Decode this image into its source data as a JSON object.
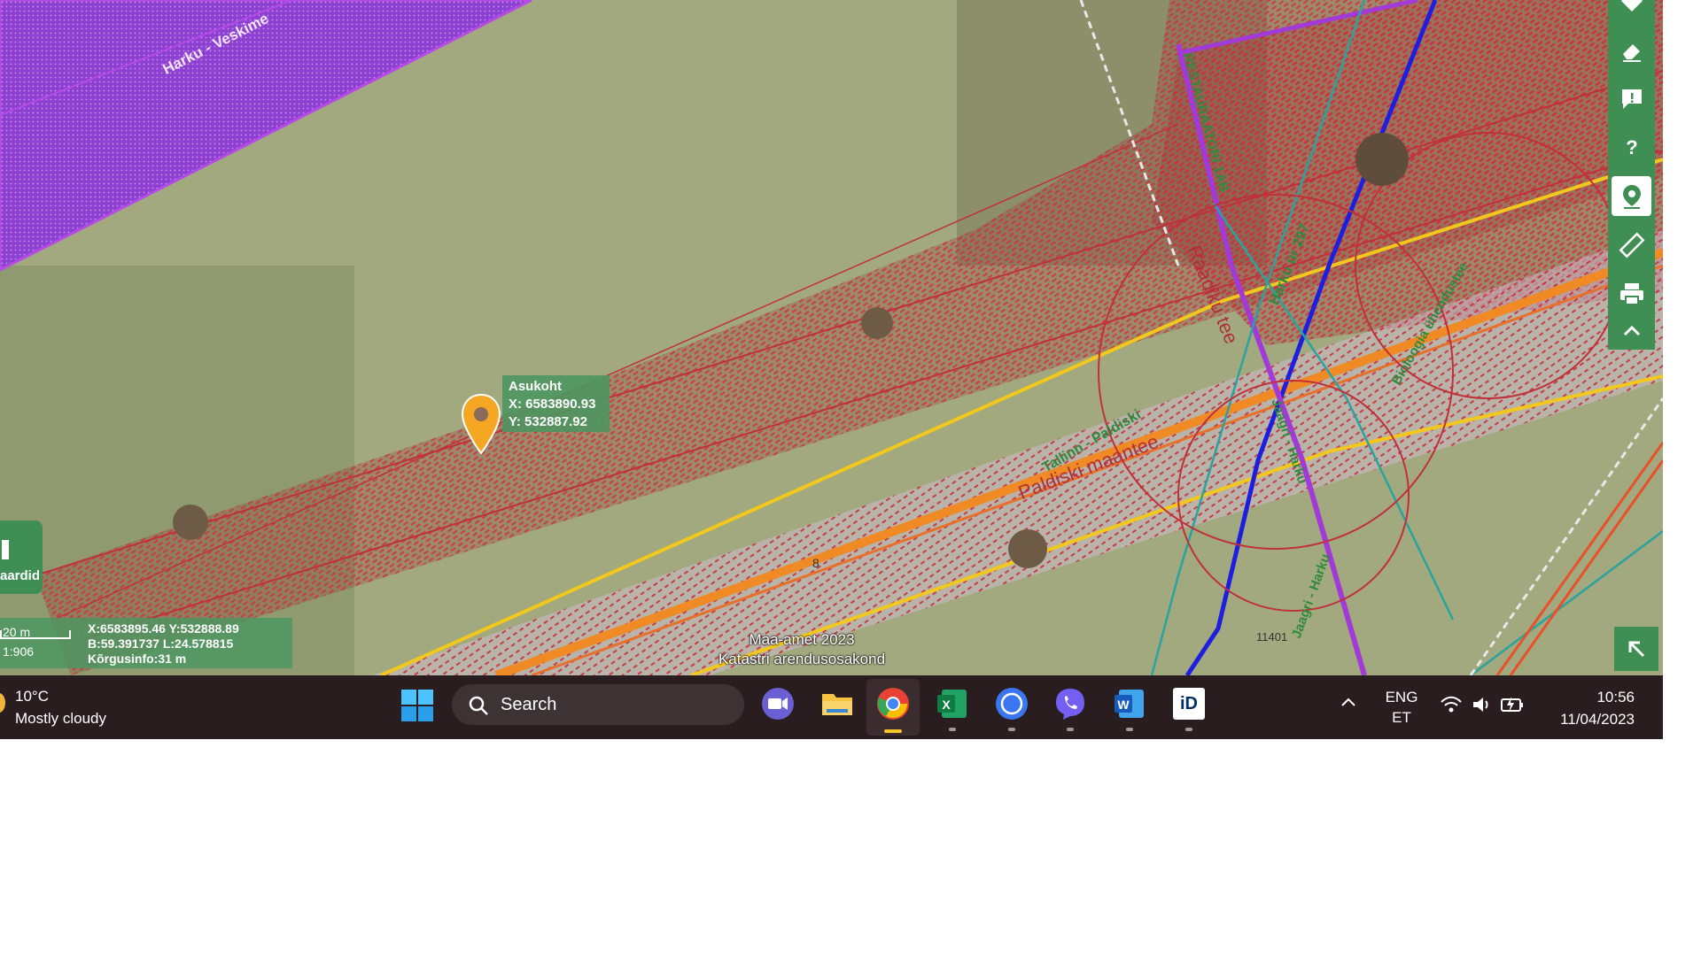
{
  "map": {
    "labels": {
      "harku_veskimetsa": "Harku - Veskime",
      "restauraatori": "RESTAURAATORI 1AB",
      "harku_ur": "Harku ür 297",
      "raadiku": "Raadiku tee",
      "tallinn_paldiski": "Tallinn - Paldiski",
      "paldiski_mnt": "Paldiski maantee",
      "biologia": "Bioloogia ühendustee",
      "jaagri_harku_1": "Jaagri - Harku",
      "jaagri_harku_2": "Jaagri - Harku",
      "num_8": "8",
      "num_11401": "11401"
    },
    "popup": {
      "title": "Asukoht",
      "x": "X: 6583890.93",
      "y": "Y: 532887.92"
    },
    "attribution": {
      "line1": "Maa-amet 2023",
      "line2": "Katastri arendusosakond"
    },
    "scale": {
      "distance": "20 m",
      "ratio": "1:906"
    },
    "coords": {
      "xy": "X:6583895.46 Y:532888.89",
      "bl": "B:59.391737 L:24.578815",
      "height": "Kõrgusinfo:31 m"
    },
    "layer_button_label": "aardid"
  },
  "toolbar": {
    "icons": [
      "directions-icon",
      "eraser-icon",
      "feedback-icon",
      "help-icon",
      "location-icon",
      "ruler-icon",
      "print-icon",
      "collapse-icon"
    ]
  },
  "taskbar": {
    "weather": {
      "temp": "10°C",
      "desc": "Mostly cloudy"
    },
    "search_label": "Search",
    "apps": [
      "zoom-icon",
      "file-explorer-icon",
      "chrome-icon",
      "excel-icon",
      "signal-icon",
      "viber-icon",
      "word-icon",
      "digidoc-icon"
    ],
    "lang": {
      "line1": "ENG",
      "line2": "ET"
    },
    "clock": {
      "time": "10:56",
      "date": "11/04/2023"
    }
  },
  "colors": {
    "accent_green": "#3f8f55",
    "taskbar_bg": "#2a1d1f",
    "hatch_red": "#c0303a",
    "purple_zone": "#9b35d6",
    "road_yellow": "#f2c81c",
    "road_orange": "#f08a24"
  }
}
